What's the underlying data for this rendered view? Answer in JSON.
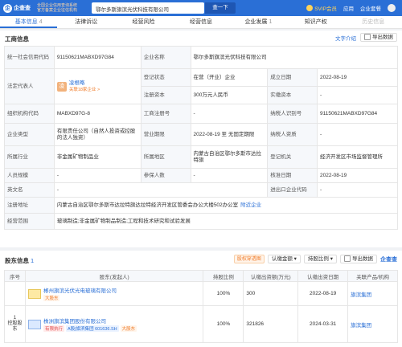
{
  "header": {
    "logo_mark": "企",
    "logo_name": "企查查",
    "logo_url": "Qcc.com",
    "slogan_line1": "全国企业信用查询系统",
    "slogan_line2": "官方备案企业征信机构",
    "search_value": "鄂尔多斯旗滨光伏科技有限公司",
    "search_button": "查一下",
    "svip": "SVIP会员",
    "menu1": "应用",
    "menu2": "企业套餐"
  },
  "tabs": [
    {
      "label": "基本信息",
      "count": "4"
    },
    {
      "label": "法律诉讼",
      "count": ""
    },
    {
      "label": "经营风险",
      "count": ""
    },
    {
      "label": "经营信息",
      "count": ""
    },
    {
      "label": "企业发展",
      "count": "1"
    },
    {
      "label": "知识产权",
      "count": ""
    },
    {
      "label": "历史信息",
      "count": ""
    }
  ],
  "registration": {
    "title": "工商信息",
    "copy_link": "文字介绍",
    "export_label": "导出数据",
    "rows": {
      "credit_code_label": "统一社会信用代码",
      "credit_code": "91150621MABXD97G84",
      "name_label": "企业名称",
      "name": "鄂尔多斯旗滨光伏科技有限公司",
      "rep_label": "法定代表人",
      "rep_initial": "凌",
      "rep_name": "凌根略",
      "rep_related": "关联18家企业 >",
      "status_label": "登记状态",
      "status": "在营（开业）企业",
      "founded_label": "成立日期",
      "founded": "2022-08-19",
      "capital_label": "注册资本",
      "capital": "300万元人民币",
      "paid_label": "实缴资本",
      "paid": "-",
      "org_code_label": "组织机构代码",
      "org_code": "MABXD97G-8",
      "biz_reg_label": "工商注册号",
      "biz_reg": "-",
      "tax_id_label": "纳税人识别号",
      "tax_id": "91150621MABXD97G84",
      "type_label": "企业类型",
      "type": "有限责任公司（自然人投资或控股的法人独资）",
      "period_label": "营业期限",
      "period": "2022-08-19 至 无固定期限",
      "taxpayer_label": "纳税人资质",
      "taxpayer": "-",
      "industry_label": "所属行业",
      "industry": "非金属矿物制品业",
      "region_label": "所属地区",
      "region": "内蒙古自治区鄂尔多斯市达拉特旗",
      "authority_label": "登记机关",
      "authority": "经济开发区市场监督管理所",
      "staff_label": "人员规模",
      "staff": "-",
      "insured_label": "参保人数",
      "insured": "-",
      "approved_label": "核准日期",
      "approved": "2022-08-19",
      "en_label": "英文名",
      "en": "-",
      "import_label": "进出口企业代码",
      "import": "-",
      "address_label": "注册地址",
      "address": "内蒙古自治区鄂尔多斯市达拉特旗达拉特经济开发区管委会办公大楼502办公室",
      "nearby": "附近企业",
      "scope_label": "经营范围",
      "scope": "玻璃制造;非金属矿物制品制造;工程和技术研究和试验发展"
    }
  },
  "shareholders": {
    "title": "股东信息",
    "count": "1",
    "tag": "股权穿透图",
    "filter1": "认缴金额",
    "filter2": "持股比例",
    "export_label": "导出数据",
    "watermark": "企查查",
    "headers": [
      "序号",
      "股东(发起人)",
      "持股比例",
      "认缴出资额(万元)",
      "认缴出资日期",
      "关联产品/机构"
    ],
    "rows": [
      {
        "index": "",
        "name": "郴州旗滨光伏光电玻璃有限公司",
        "tags": [
          "大股东"
        ],
        "ratio": "100%",
        "amount": "300",
        "date": "2022-08-19",
        "brand": "旗滨集团"
      },
      {
        "index": "1",
        "side_text": "控股股东",
        "name": "株洲旗滨集团股份有限公司",
        "tags": [
          "有限执行",
          "A股|旗滨集团 601636.SH",
          "大股东"
        ],
        "ratio": "100%",
        "amount": "321826",
        "date": "2024-03-31",
        "brand": "旗滨集团"
      }
    ]
  }
}
